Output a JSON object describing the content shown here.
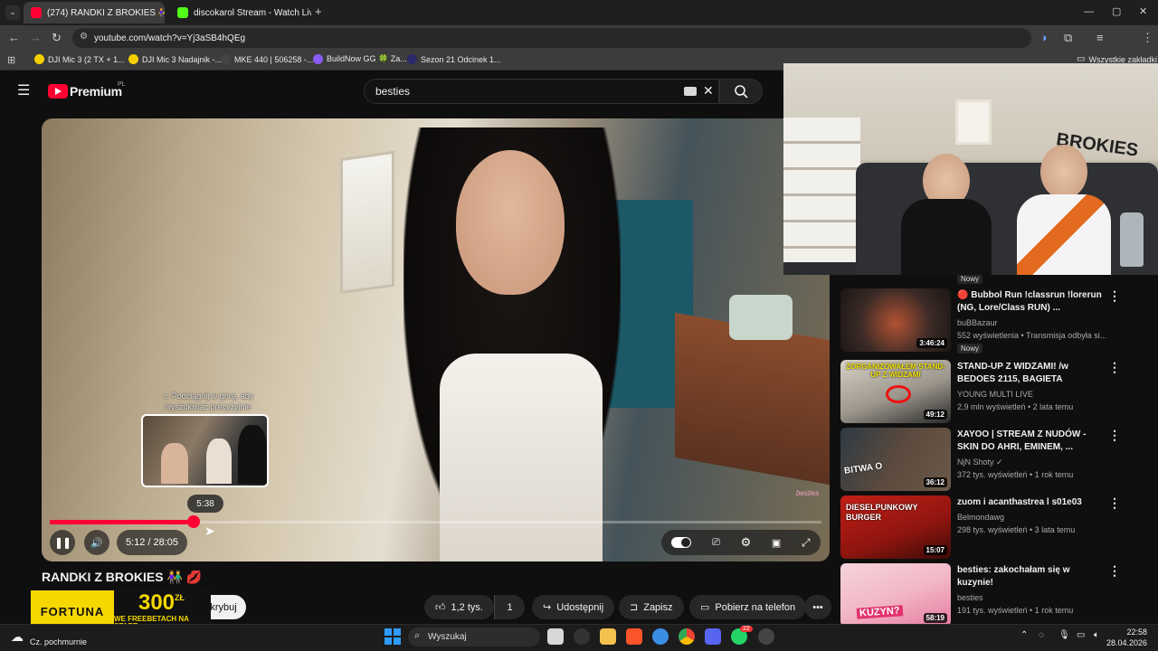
{
  "browser": {
    "tabs": [
      {
        "title": "(274) RANDKI Z BROKIES 👫 🔊",
        "active": true
      },
      {
        "title": "discokarol Stream - Watch Live",
        "active": false
      }
    ],
    "new_tab": "+",
    "window_controls": [
      "—",
      "▢",
      "✕"
    ],
    "url": "youtube.com/watch?v=Yj3aSB4hQEg",
    "bookmarks": [
      "DJI Mic 3 (2 TX + 1...",
      "DJI Mic 3 Nadajnik -...",
      "MKE 440 | 506258 -...",
      "BuildNow GG 🍀 Za...",
      "Sezon 21 Odcinek 1..."
    ],
    "bookmarks_all": "Wszystkie zakładki"
  },
  "youtube": {
    "logo_text": "Premium",
    "logo_region": "PL",
    "search_value": "besties",
    "player": {
      "hint": "⌅ Podciągnij w górę, aby wyszukiwać precyzyjnie",
      "preview_time": "5:38",
      "time_display": "5:12 / 28:05",
      "progress_fraction": 0.186,
      "hover_fraction": 0.202,
      "watermark": "besties"
    },
    "video_title": "RANDKI Z BROKIES 👫 💋",
    "subscribe_label": "krybuj",
    "actions": {
      "like_count": "1,2 tys.",
      "dislike_count": "1",
      "share": "Udostępnij",
      "save": "Zapisz",
      "download": "Pobierz na telefon",
      "more": "•••"
    },
    "ad": {
      "brand": "FORTUNA",
      "amount": "300",
      "currency": "ZŁ",
      "tagline": "WE FREEBETACH NA START"
    },
    "sidebar": {
      "top_badge": "Nowy",
      "videos": [
        {
          "title": "🔴 Bubbol Run !classrun !lorerun (NG, Lore/Class RUN) ...",
          "channel": "buBBazaur",
          "meta": "552 wyświetlenia • Transmisja odbyła si...",
          "duration": "3:46:24",
          "badge": "Nowy",
          "colors": [
            "#3a2a26",
            "#7c3b2e"
          ]
        },
        {
          "title": "STAND-UP Z WIDZAMI! /w BEDOES 2115, BAGIETA",
          "channel": "YOUNG MULTI LIVE",
          "meta": "2,9 mln wyświetleń • 2 lata temu",
          "duration": "49:12",
          "badge": "",
          "colors": [
            "#c9c1b3",
            "#c91f1f"
          ],
          "thumb_text": "ZORGANIZOWAŁEM STAND-UP Z WIDZAMI"
        },
        {
          "title": "XAYOO | STREAM Z NUDÓW - SKIN DO AHRI, EMINEM, ...",
          "channel": "NjN Shoty ✓",
          "meta": "372 tys. wyświetleń • 1 rok temu",
          "duration": "36:12",
          "badge": "",
          "colors": [
            "#2e3a44",
            "#6b5a4a"
          ],
          "thumb_text": "BITWA O"
        },
        {
          "title": "zuom i acanthastrea l s01e03",
          "channel": "Belmondawg",
          "meta": "298 tys. wyświetleń • 3 lata temu",
          "duration": "15:07",
          "badge": "",
          "colors": [
            "#b21d14",
            "#f3c22b"
          ],
          "thumb_text": "DIESELPUNKOWY BURGER"
        },
        {
          "title": "besties: zakochałam się w kuzynie!",
          "channel": "besties",
          "meta": "191 tys. wyświetleń • 1 rok temu",
          "duration": "58:19",
          "badge": "",
          "colors": [
            "#f2b8c6",
            "#e77aa0"
          ],
          "thumb_text": "KUZYN?"
        }
      ]
    }
  },
  "stream": {
    "sign_text": "BROKIES"
  },
  "taskbar": {
    "weather": "Cz. pochmurnie",
    "search_placeholder": "Wyszukaj",
    "notification_count": "22",
    "time": "22:58",
    "date": "28.04.2026"
  },
  "colors": {
    "accent": "#ff0033",
    "background": "#0f0f0f",
    "ad_yellow": "#f5d800"
  }
}
